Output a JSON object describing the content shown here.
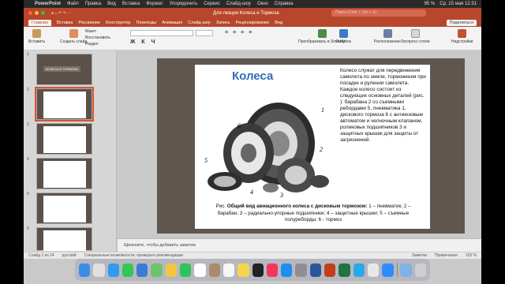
{
  "menubar": {
    "apple": "",
    "app": "PowerPoint",
    "items": [
      "Файл",
      "Правка",
      "Вид",
      "Вставка",
      "Формат",
      "Упорядочить",
      "Сервис",
      "Слайд-шоу",
      "Окно",
      "Справка"
    ],
    "battery": "95 %",
    "clock": "Ср, 15 мая  12:31"
  },
  "window": {
    "title": "Для лекции Колеса и Тормоза",
    "search_placeholder": "Поиск (Cmd + Ctrl + U)"
  },
  "tabs": {
    "items": [
      "Главная",
      "Вставка",
      "Рисование",
      "Конструктор",
      "Переходы",
      "Анимация",
      "Слайд-шоу",
      "Запись",
      "Рецензирование",
      "Вид"
    ],
    "share": "Поделиться"
  },
  "ribbon": {
    "paste": "Вставить",
    "new_slide": "Создать слайд",
    "layout": "Макет",
    "reset": "Восстановить",
    "section": "Раздел",
    "convert": "Преобразовать в SmartArt",
    "picture": "Рисунок",
    "arrange": "Расположение",
    "quick_styles": "Экспресс-стили",
    "addins": "Надстройки"
  },
  "slides": [
    {
      "num": "1",
      "title": "КОЛЕСА И ТОРМОЗА"
    },
    {
      "num": "2",
      "title": "Колеса"
    },
    {
      "num": "3",
      "title": ""
    },
    {
      "num": "4",
      "title": ""
    },
    {
      "num": "5",
      "title": ""
    },
    {
      "num": "6",
      "title": ""
    }
  ],
  "slide": {
    "title": "Колеса",
    "body": "Колесо служат для передвижения самолета по земле, торможения при посадке и рулении самолета.\nКаждое колесо состоит из следующих основных деталей (рис.   ): барабана 2 со съемными ребордами 5, пневматика  1, дискового тормоза 6 с антиюзовым автоматом и челночным клапаном, роликовых подшипников 3 и защитных крышек  для защиты от загрязнений.",
    "caption_prefix": "Рис.   ",
    "caption_bold": "Общий вид авиационного колеса с дисковым тормозом:",
    "caption_rest": " 1 – пневматик; 2 – барабан; 3 – радиально-упорные подшипники; 4 – защитные крышки; 5 – съемные полуреборды; 6 - тормоз",
    "labels": [
      "1",
      "2",
      "3",
      "4",
      "5",
      "6"
    ]
  },
  "notes": "Щелкните, чтобы добавить заметки",
  "status": {
    "slide": "Слайд 2 из 24",
    "lang": "русский",
    "accessibility": "Специальные возможности: проверьте рекомендации",
    "notes": "Заметки",
    "comments": "Примечания",
    "zoom": "103 %"
  },
  "colors": {
    "accent": "#b8462a",
    "slide_bg": "#5f5650",
    "title": "#2d6fb3"
  }
}
